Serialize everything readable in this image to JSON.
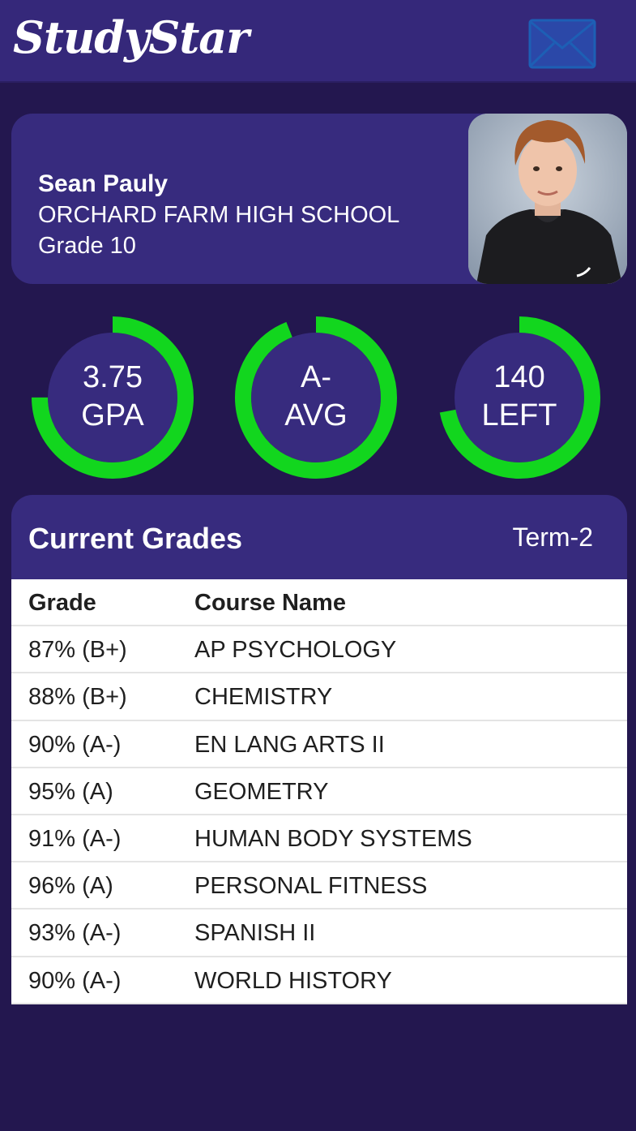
{
  "app": {
    "title": "StudySt​ar"
  },
  "header": {
    "brand": "StudyStar",
    "mail_icon": "envelope-icon"
  },
  "profile": {
    "name": "Sean Pauly",
    "school": "ORCHARD FARM HIGH SCHOOL",
    "grade": "Grade 10"
  },
  "stats": [
    {
      "value": "3.75",
      "label": "GPA",
      "progress": 0.75
    },
    {
      "value": "A-",
      "label": "AVG",
      "progress": 0.94
    },
    {
      "value": "140",
      "label": "LEFT",
      "progress": 0.72
    }
  ],
  "colors": {
    "background": "#23174f",
    "card": "#372b7e",
    "accent_ring": "#12d61e",
    "mail_icon": "#1d5fb5"
  },
  "grades": {
    "title": "Current Grades",
    "term": "Term-2",
    "columns": [
      "Grade",
      "Course Name"
    ],
    "rows": [
      {
        "grade": "87% (B+)",
        "course": "AP PSYCHOLOGY"
      },
      {
        "grade": "88% (B+)",
        "course": "CHEMISTRY"
      },
      {
        "grade": "90% (A-)",
        "course": "EN LANG ARTS II"
      },
      {
        "grade": "95% (A)",
        "course": "GEOMETRY"
      },
      {
        "grade": "91% (A-)",
        "course": "HUMAN BODY SYSTEMS"
      },
      {
        "grade": "96% (A)",
        "course": "PERSONAL FITNESS"
      },
      {
        "grade": "93% (A-)",
        "course": "SPANISH II"
      },
      {
        "grade": "90% (A-)",
        "course": "WORLD HISTORY"
      }
    ]
  }
}
